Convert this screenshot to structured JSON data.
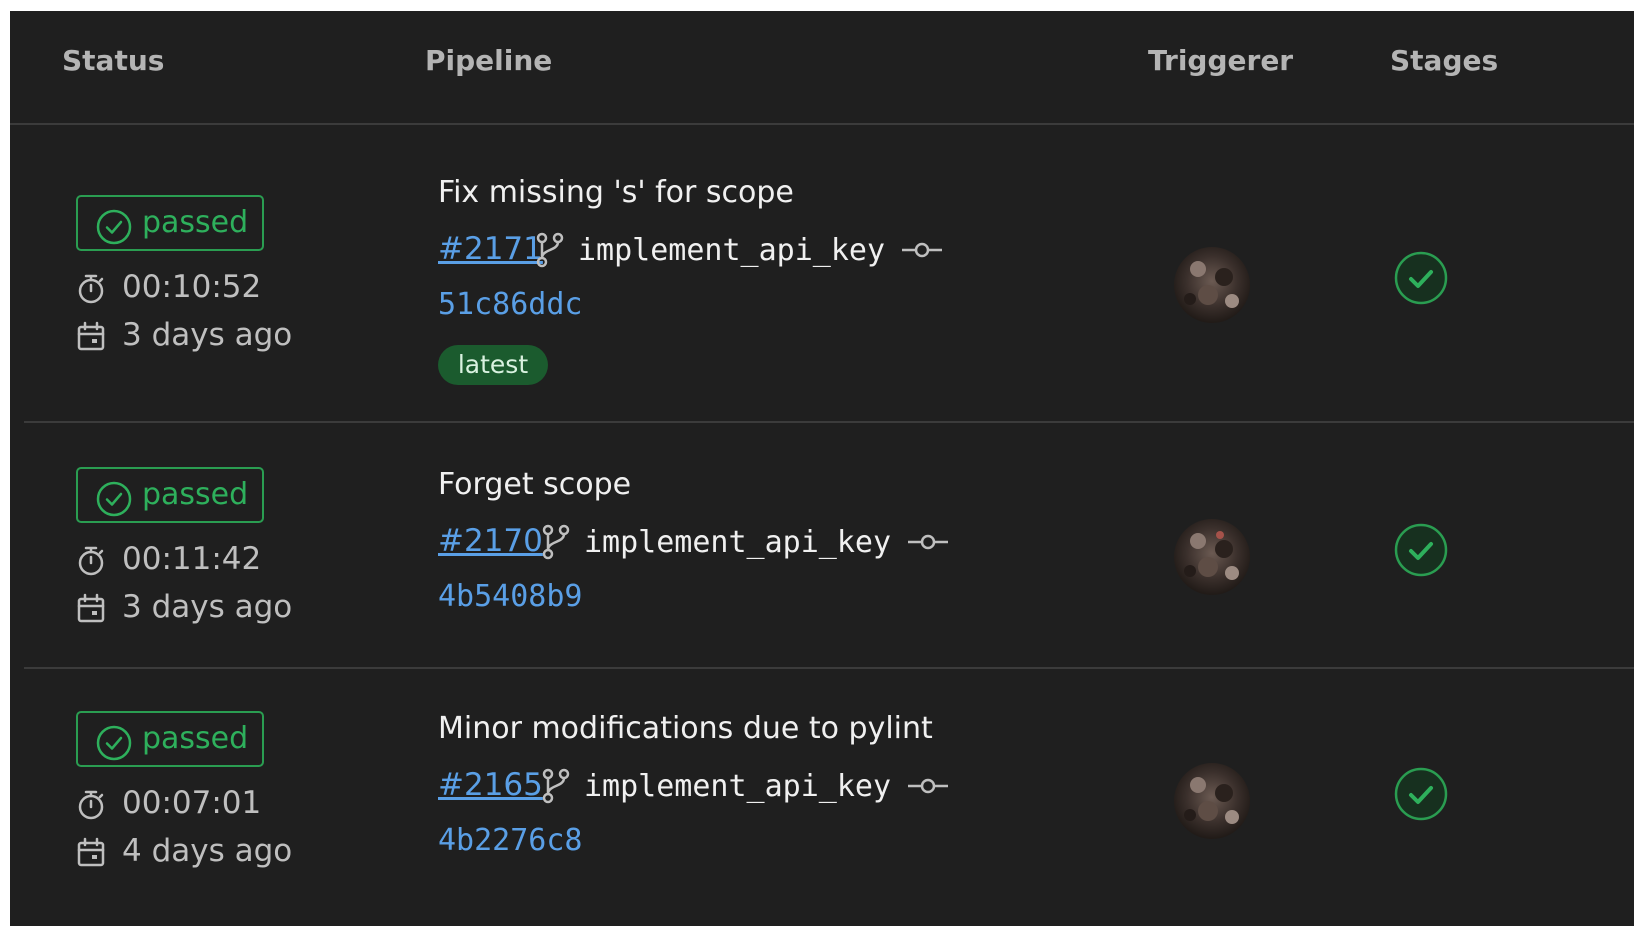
{
  "header": {
    "status": "Status",
    "pipeline": "Pipeline",
    "triggerer": "Triggerer",
    "stages": "Stages"
  },
  "colors": {
    "background": "#1f1f1f",
    "passed": "#2eb05c",
    "link": "#5a9fe6",
    "tag_bg": "#1b5b2e"
  },
  "pipelines": [
    {
      "status": "passed",
      "duration": "00:10:52",
      "finished": "3 days ago",
      "title": "Fix missing 's' for scope",
      "id": "#2171",
      "branch": "implement_api_key",
      "sha": "51c86ddc",
      "tag": "latest",
      "stage_status": "passed"
    },
    {
      "status": "passed",
      "duration": "00:11:42",
      "finished": "3 days ago",
      "title": "Forget scope",
      "id": "#2170",
      "branch": "implement_api_key",
      "sha": "4b5408b9",
      "stage_status": "passed"
    },
    {
      "status": "passed",
      "duration": "00:07:01",
      "finished": "4 days ago",
      "title": "Minor modifications due to pylint",
      "id": "#2165",
      "branch": "implement_api_key",
      "sha": "4b2276c8",
      "stage_status": "passed"
    }
  ],
  "icons": {
    "status": "check-circle-icon",
    "duration": "stopwatch-icon",
    "finished": "calendar-icon",
    "branch": "git-branch-icon",
    "commit": "git-commit-icon",
    "stage": "stage-check-icon"
  }
}
